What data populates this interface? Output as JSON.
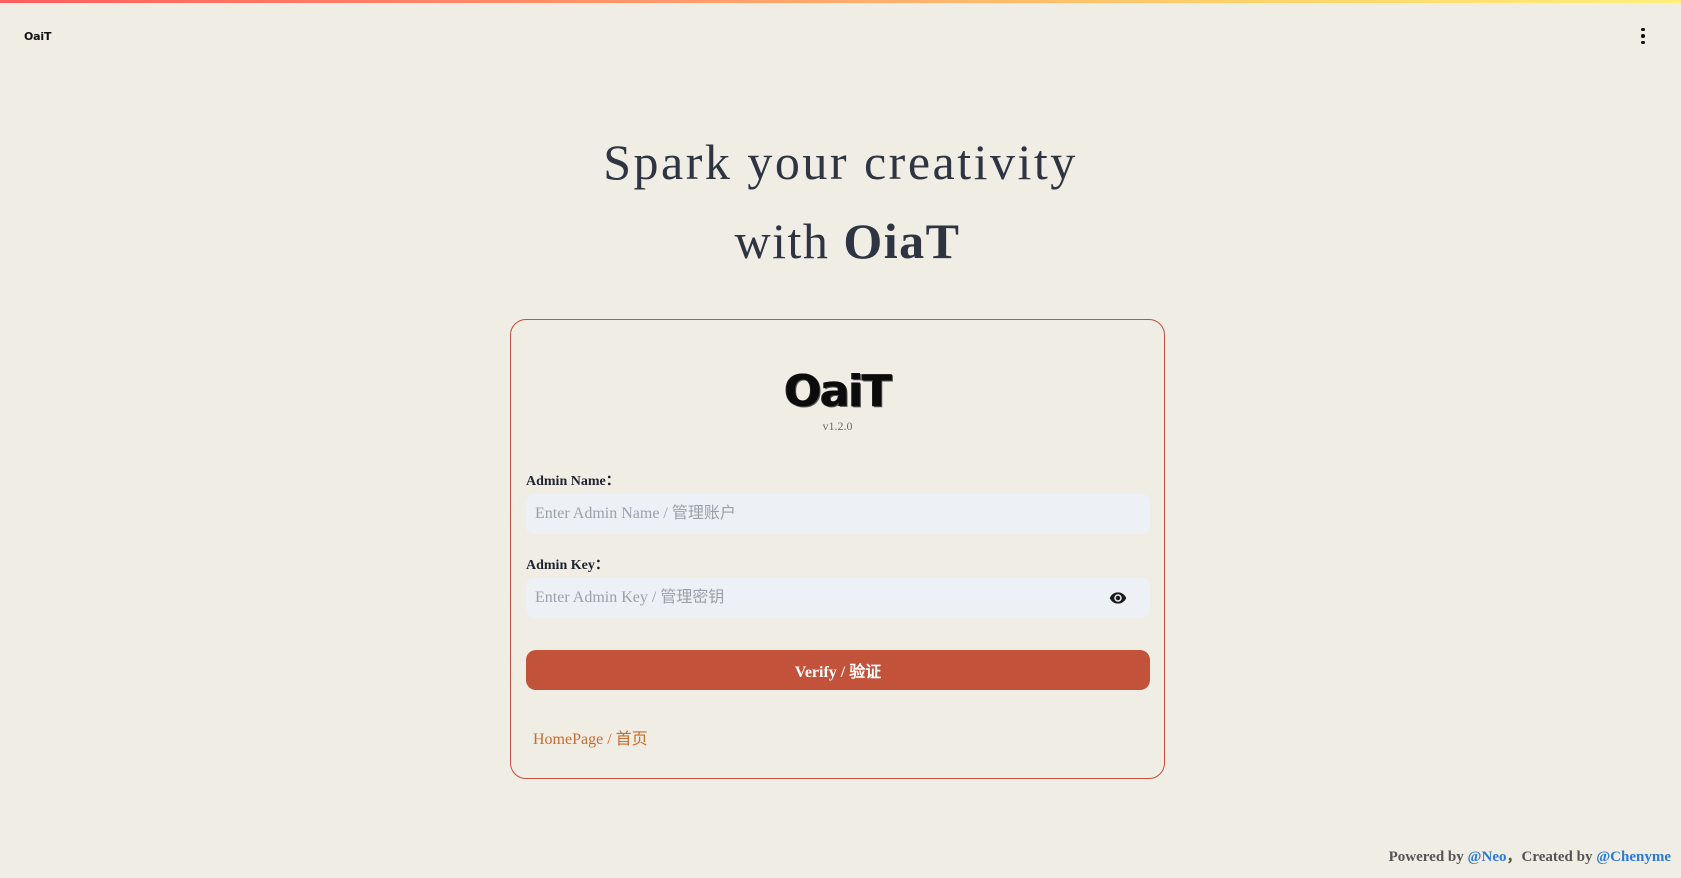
{
  "header": {
    "logo_text": "OaiT",
    "menu_icon": "more-vertical-icon"
  },
  "hero": {
    "line1": "Spark your creativity",
    "line2_prefix": "with ",
    "line2_brand": "OiaT"
  },
  "card": {
    "logo_text": "OaiT",
    "version": "v1.2.0",
    "admin_name": {
      "label": "Admin Name：",
      "value": "",
      "placeholder": "Enter Admin Name / 管理账户"
    },
    "admin_key": {
      "label": "Admin Key：",
      "value": "",
      "placeholder": "Enter Admin Key / 管理密钥",
      "toggle_icon": "eye-icon"
    },
    "verify_label": "Verify / 验证",
    "homepage_link": "HomePage / 首页"
  },
  "footer": {
    "powered_prefix": "Powered by ",
    "powered_link": "@Neo",
    "separator": "，",
    "created_prefix": "Created by ",
    "created_link": "@Chenyme"
  },
  "colors": {
    "background": "#f0ede4",
    "accent": "#c3523b",
    "card_border": "#c5503c",
    "link": "#c86b2c",
    "footer_link": "#2a7bd6",
    "input_bg": "#edf0f4"
  }
}
